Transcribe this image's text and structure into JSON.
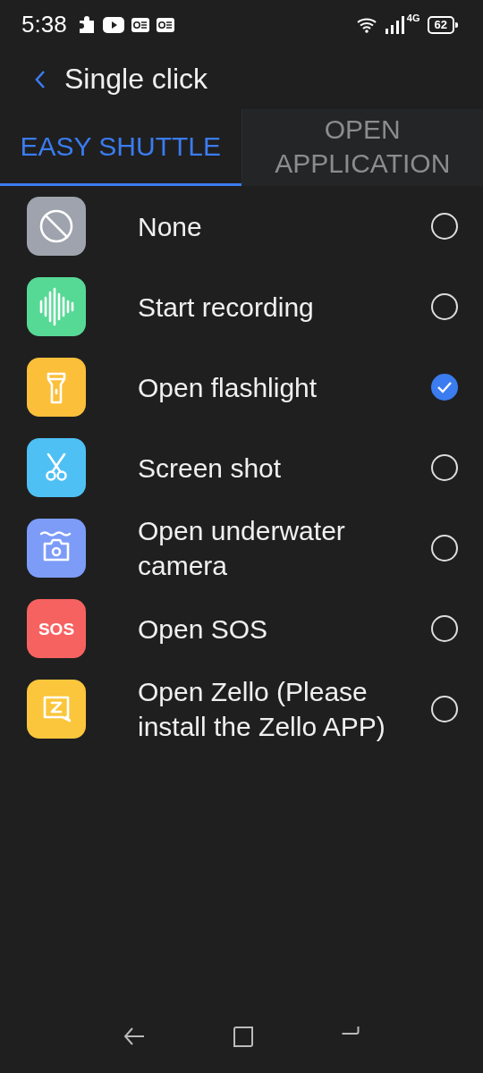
{
  "status_bar": {
    "time": "5:38",
    "network": "4G",
    "battery": "62"
  },
  "header": {
    "title": "Single click"
  },
  "tabs": [
    {
      "label": "EASY SHUTTLE",
      "selected": true
    },
    {
      "label": "OPEN APPLICATION",
      "selected": false
    }
  ],
  "options": [
    {
      "kind": "none",
      "color": "#9ea3ad",
      "label": "None",
      "selected": false
    },
    {
      "kind": "recording",
      "color": "#57d996",
      "label": "Start recording",
      "selected": false
    },
    {
      "kind": "flashlight",
      "color": "#fbbf3a",
      "label": "Open flashlight",
      "selected": true
    },
    {
      "kind": "scissors",
      "color": "#4fc0f4",
      "label": "Screen shot",
      "selected": false
    },
    {
      "kind": "camera",
      "color": "#7d9cf8",
      "label": "Open underwater camera",
      "selected": false
    },
    {
      "kind": "sos",
      "color": "#f66260",
      "badge": "SOS",
      "label": "Open SOS",
      "selected": false
    },
    {
      "kind": "zello",
      "color": "#fbc63c",
      "label": "Open Zello (Please install the Zello APP)",
      "selected": false
    }
  ]
}
